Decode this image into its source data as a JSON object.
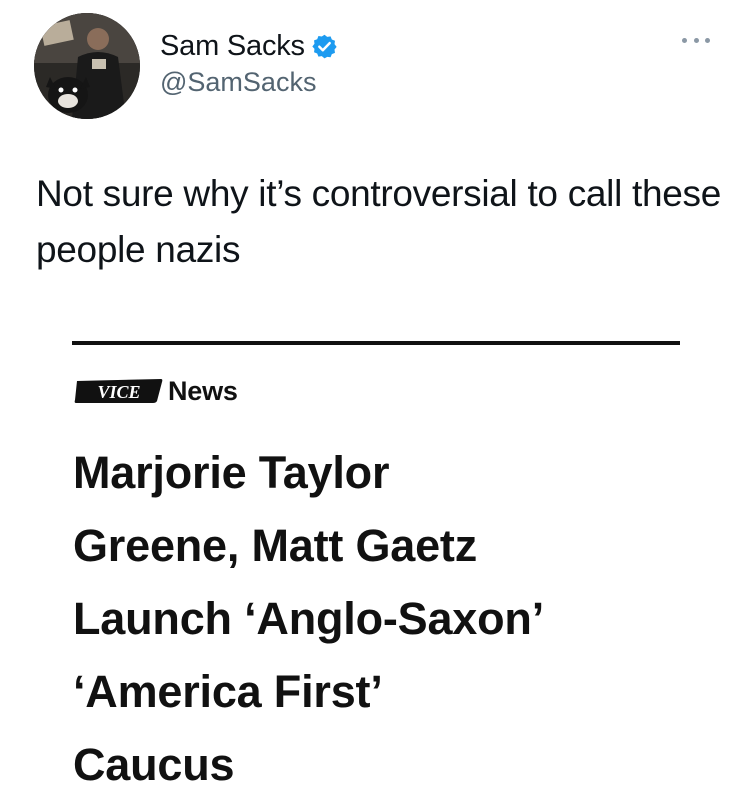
{
  "author": {
    "name": "Sam Sacks",
    "handle": "@SamSacks",
    "verified": true,
    "verified_color": "#1d9bf0"
  },
  "tweet": {
    "text": "Not sure why it’s controversial to call these people nazis"
  },
  "media": {
    "brand_logo_text": "VICE",
    "brand_label": "News",
    "headline_lines": [
      "Marjorie Taylor",
      "Greene, Matt Gaetz",
      "Launch ‘Anglo-Saxon’",
      "‘America First’",
      "Caucus"
    ]
  },
  "icons": {
    "more": "more-horizontal-icon",
    "verified": "verified-badge-icon"
  }
}
